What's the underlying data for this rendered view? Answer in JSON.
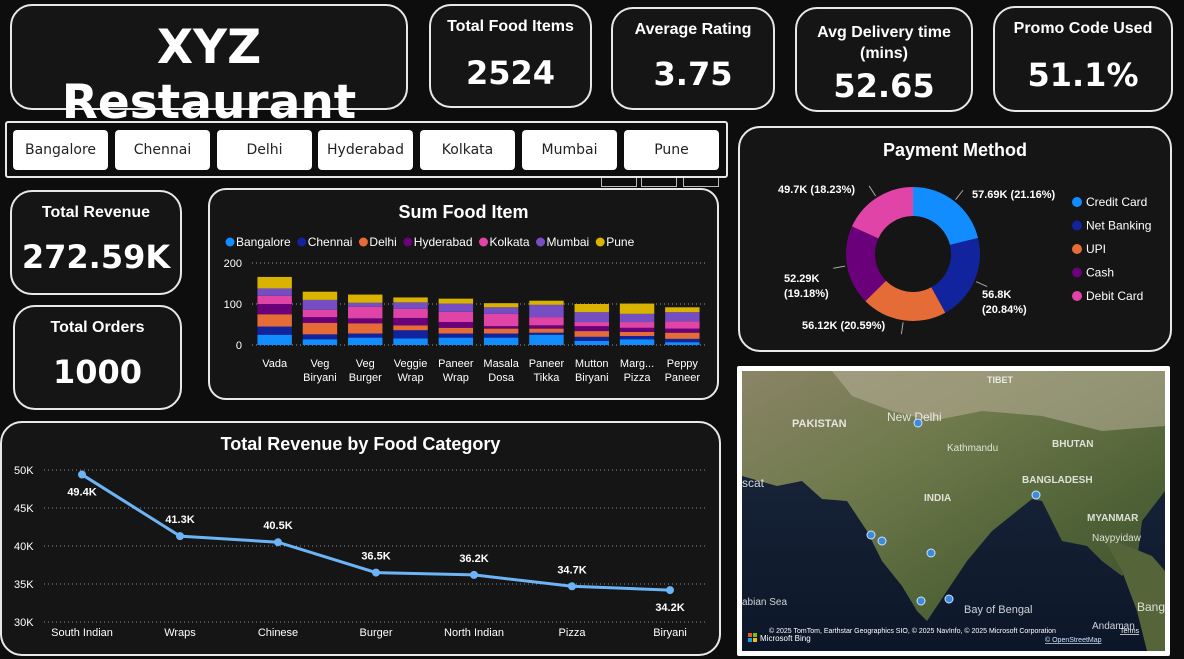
{
  "brand": "XYZ Restaurant",
  "kpis": {
    "total_food_items": {
      "label": "Total Food Items",
      "value": "2524"
    },
    "average_rating": {
      "label": "Average Rating",
      "value": "3.75"
    },
    "avg_delivery": {
      "label": "Avg Delivery time (mins)",
      "value": "52.65"
    },
    "promo_code": {
      "label": "Promo Code Used",
      "value": "51.1%"
    },
    "total_revenue": {
      "label": "Total Revenue",
      "value": "272.59K"
    },
    "total_orders": {
      "label": "Total Orders",
      "value": "1000"
    }
  },
  "cities": [
    "Bangalore",
    "Chennai",
    "Delhi",
    "Hyderabad",
    "Kolkata",
    "Mumbai",
    "Pune"
  ],
  "map": {
    "labels": [
      "PAKISTAN",
      "New Delhi",
      "Kathmandu",
      "TIBET",
      "BHUTAN",
      "BANGLADESH",
      "INDIA",
      "MYANMAR",
      "Naypyidaw",
      "scat",
      "abian Sea",
      "Bay of Bengal",
      "Andaman",
      "Bang"
    ],
    "credit": "© 2025 TomTom, Earthstar Geographics SIO, © 2025 NavInfo, © 2025 Microsoft Corporation",
    "terms": "Terms",
    "osm": "© OpenStreetMap",
    "bing": "Microsoft Bing"
  },
  "colors": {
    "Bangalore": "#118dff",
    "Chennai": "#12239e",
    "Delhi": "#e66c37",
    "Hyderabad": "#6b007b",
    "Kolkata": "#e044a7",
    "Mumbai": "#744ec2",
    "Pune": "#d9b300",
    "line": "#6cb4f5"
  },
  "chart_data": [
    {
      "type": "bar",
      "stacked": true,
      "title": "Sum Food Item",
      "categories": [
        "Vada",
        "Veg Biryani",
        "Veg Burger",
        "Veggie Wrap",
        "Paneer Wrap",
        "Masala Dosa",
        "Paneer Tikka",
        "Mutton Biryani",
        "Marg... Pizza",
        "Peppy Paneer"
      ],
      "series": [
        {
          "name": "Bangalore",
          "values": [
            25,
            14,
            18,
            16,
            18,
            18,
            25,
            10,
            14,
            7
          ]
        },
        {
          "name": "Chennai",
          "values": [
            20,
            12,
            10,
            20,
            10,
            10,
            5,
            10,
            8,
            8
          ]
        },
        {
          "name": "Delhi",
          "values": [
            30,
            28,
            25,
            12,
            14,
            12,
            10,
            14,
            10,
            15
          ]
        },
        {
          "name": "Hyderabad",
          "values": [
            25,
            14,
            12,
            18,
            14,
            6,
            8,
            12,
            10,
            10
          ]
        },
        {
          "name": "Kolkata",
          "values": [
            20,
            18,
            28,
            22,
            25,
            30,
            20,
            10,
            14,
            18
          ]
        },
        {
          "name": "Mumbai",
          "values": [
            18,
            24,
            10,
            16,
            20,
            16,
            30,
            24,
            20,
            22
          ]
        },
        {
          "name": "Pune",
          "values": [
            28,
            20,
            20,
            12,
            12,
            10,
            10,
            20,
            25,
            12
          ]
        }
      ],
      "yticks": [
        0,
        100,
        200
      ],
      "ylim": [
        0,
        200
      ],
      "legend": "top-left"
    },
    {
      "type": "line",
      "title": "Total Revenue by Food Category",
      "categories": [
        "South Indian",
        "Wraps",
        "Chinese",
        "Burger",
        "North Indian",
        "Pizza",
        "Biryani"
      ],
      "values": [
        49.4,
        41.3,
        40.5,
        36.5,
        36.2,
        34.7,
        34.2
      ],
      "labels": [
        "49.4K",
        "41.3K",
        "40.5K",
        "36.5K",
        "36.2K",
        "34.7K",
        "34.2K"
      ],
      "yticks": [
        "30K",
        "35K",
        "40K",
        "45K",
        "50K"
      ],
      "ylim": [
        30,
        50
      ],
      "unit": "K"
    },
    {
      "type": "pie",
      "donut": true,
      "title": "Payment Method",
      "categories": [
        "Credit Card",
        "Net Banking",
        "UPI",
        "Cash",
        "Debit Card"
      ],
      "values": [
        57.69,
        56.8,
        56.12,
        52.29,
        49.7
      ],
      "labels": [
        "57.69K (21.16%)",
        "56.8K (20.84%)",
        "56.12K (20.59%)",
        "52.29K (19.18%)",
        "49.7K (18.23%)"
      ],
      "colors": [
        "#118dff",
        "#12239e",
        "#e66c37",
        "#6b007b",
        "#e044a7"
      ],
      "legend": "right"
    }
  ]
}
